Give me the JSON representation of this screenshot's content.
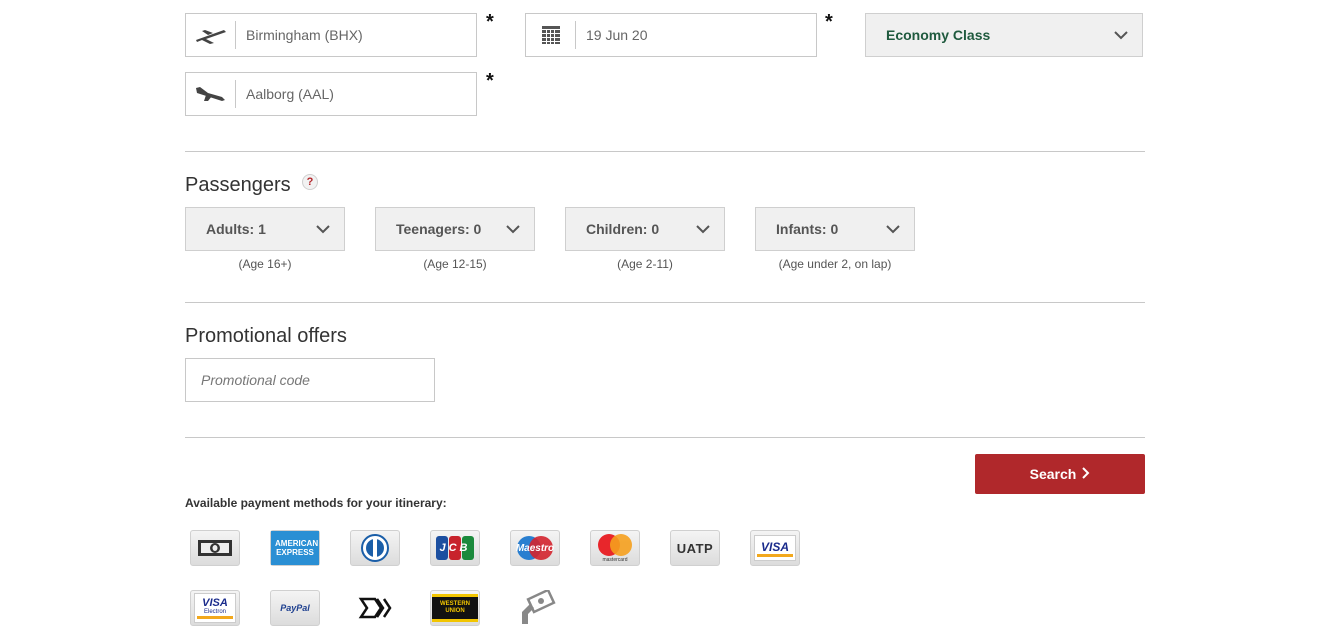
{
  "trip": {
    "origin": "Birmingham (BHX)",
    "destination": "Aalborg (AAL)",
    "date": "19 Jun 20",
    "cabin_class": "Economy Class",
    "required_mark": "*"
  },
  "passengers": {
    "heading": "Passengers",
    "help": "?",
    "types": [
      {
        "label": "Adults: 1",
        "age": "(Age 16+)"
      },
      {
        "label": "Teenagers: 0",
        "age": "(Age 12-15)"
      },
      {
        "label": "Children: 0",
        "age": "(Age 2-11)"
      },
      {
        "label": "Infants: 0",
        "age": "(Age under 2, on lap)"
      }
    ]
  },
  "promo": {
    "heading": "Promotional offers",
    "placeholder": "Promotional code"
  },
  "search": {
    "label": "Search"
  },
  "payment": {
    "title": "Available payment methods for your itinerary:",
    "methods": [
      {
        "name": "cash-icon"
      },
      {
        "name": "american-express-icon",
        "text": "AMERICAN EXPRESS"
      },
      {
        "name": "diners-club-icon"
      },
      {
        "name": "jcb-icon",
        "text": "JCB"
      },
      {
        "name": "maestro-icon",
        "text": "Maestro"
      },
      {
        "name": "mastercard-icon",
        "text": "mastercard"
      },
      {
        "name": "uatp-icon",
        "text": "UATP"
      },
      {
        "name": "visa-icon",
        "text": "VISA"
      },
      {
        "name": "visa-electron-icon",
        "text": "VISA",
        "sub": "Electron"
      },
      {
        "name": "paypal-icon",
        "text": "PayPal"
      },
      {
        "name": "direct-debit-icon"
      },
      {
        "name": "western-union-icon",
        "text": "WESTERN UNION"
      },
      {
        "name": "pay-later-icon"
      }
    ]
  },
  "colors": {
    "accent": "#b0282b",
    "cabin_text": "#1f5a3e",
    "divider": "#c8c8c8",
    "select_bg": "#f0f0f0"
  }
}
